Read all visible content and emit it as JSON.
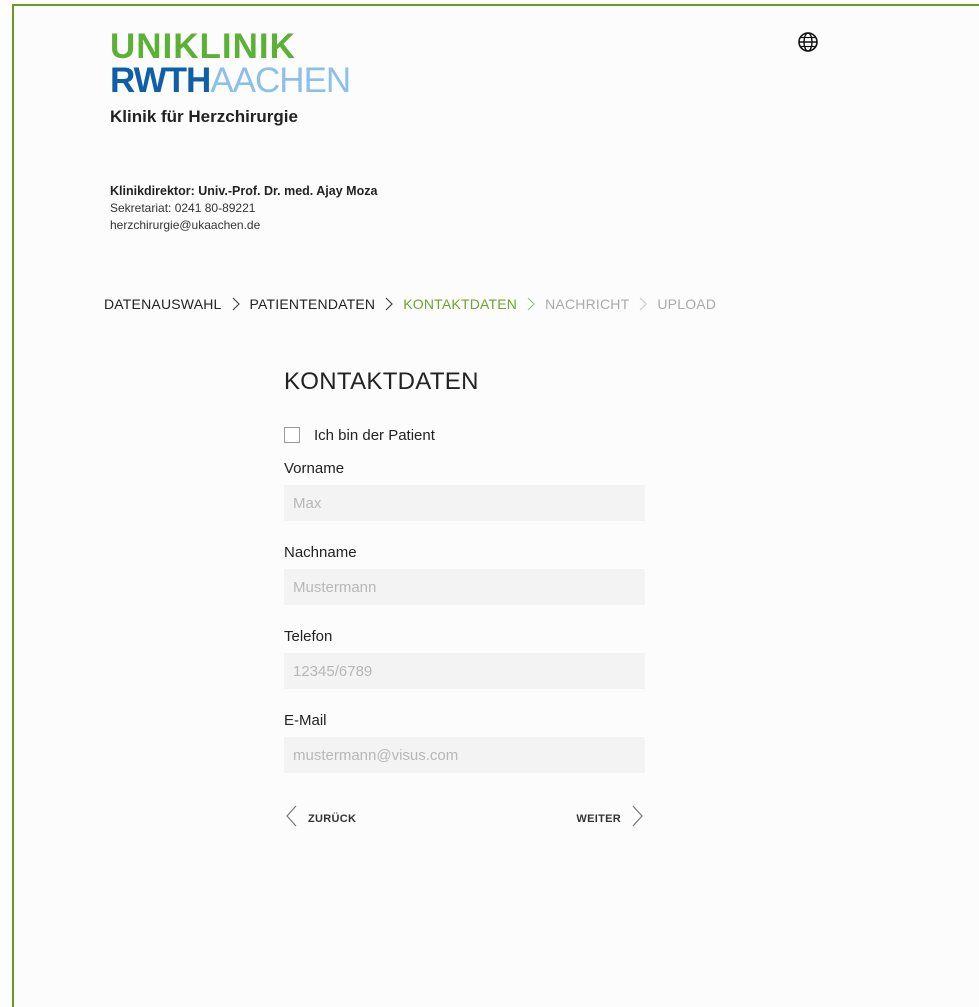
{
  "logo": {
    "line1": "UNIKLINIK",
    "line2a": "RWTH",
    "line2b": "AACHEN"
  },
  "clinic_name": "Klinik für Herzchirurgie",
  "director": {
    "title": "Klinikdirektor: Univ.-Prof. Dr. med. Ajay Moza",
    "secretariat": "Sekretariat: 0241 80-89221",
    "email": "herzchirurgie@ukaachen.de"
  },
  "breadcrumb": {
    "steps": [
      {
        "label": "DATENAUSWAHL",
        "state": "done"
      },
      {
        "label": "PATIENTENDATEN",
        "state": "done"
      },
      {
        "label": "KONTAKTDATEN",
        "state": "active"
      },
      {
        "label": "NACHRICHT",
        "state": "future"
      },
      {
        "label": "UPLOAD",
        "state": "future"
      }
    ]
  },
  "form": {
    "title": "KONTAKTDATEN",
    "checkbox_label": "Ich bin der Patient",
    "checkbox_checked": false,
    "first_name": {
      "label": "Vorname",
      "value": "",
      "placeholder": "Max"
    },
    "last_name": {
      "label": "Nachname",
      "value": "",
      "placeholder": "Mustermann"
    },
    "phone": {
      "label": "Telefon",
      "value": "",
      "placeholder": "12345/6789"
    },
    "email": {
      "label": "E-Mail",
      "value": "",
      "placeholder": "mustermann@visus.com"
    }
  },
  "nav": {
    "back_label": "ZURÜCK",
    "next_label": "WEITER"
  },
  "colors": {
    "brand_green": "#5bb135",
    "brand_blue": "#0f5fa8",
    "brand_light_blue": "#8cc0ea",
    "active_step": "#6aa52a"
  },
  "icons": {
    "language": "globe-icon",
    "separator": "chevron-right-icon",
    "back": "chevron-left-icon",
    "next": "chevron-right-icon"
  }
}
